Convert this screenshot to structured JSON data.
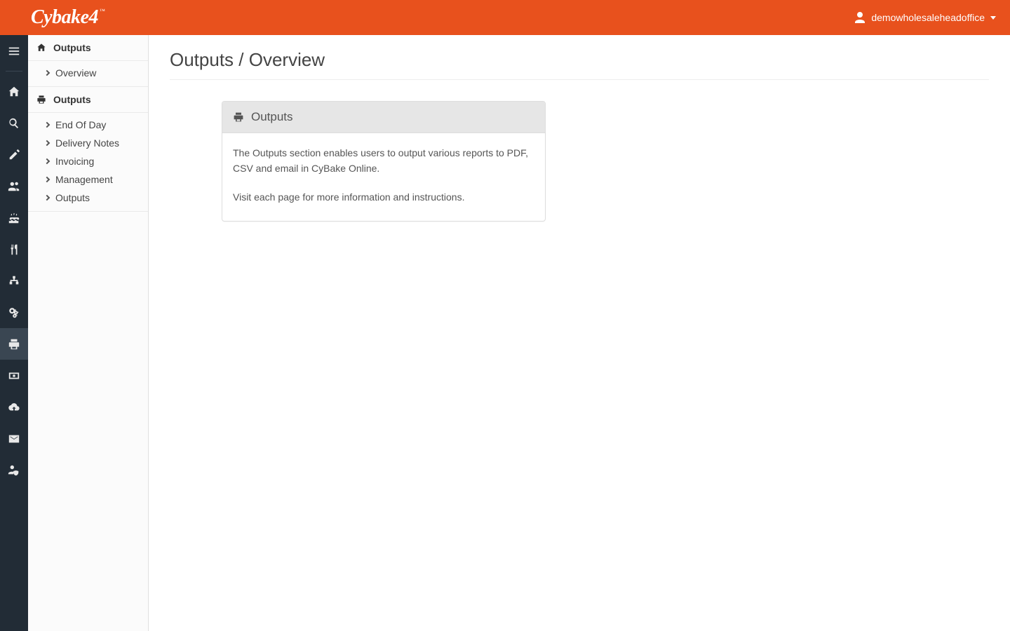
{
  "brand": "Cybake4",
  "header": {
    "username": "demowholesaleheadoffice"
  },
  "rail": [
    {
      "id": "menu",
      "icon": "bars-icon"
    },
    {
      "id": "home",
      "icon": "home-icon"
    },
    {
      "id": "search",
      "icon": "search-icon"
    },
    {
      "id": "edit",
      "icon": "edit-icon"
    },
    {
      "id": "users",
      "icon": "users-icon"
    },
    {
      "id": "cake",
      "icon": "cake-icon"
    },
    {
      "id": "food",
      "icon": "utensils-icon"
    },
    {
      "id": "org",
      "icon": "sitemap-icon"
    },
    {
      "id": "cogs",
      "icon": "cogs-icon"
    },
    {
      "id": "print",
      "icon": "print-icon",
      "active": true
    },
    {
      "id": "money",
      "icon": "money-icon"
    },
    {
      "id": "cloud",
      "icon": "cloud-download-icon"
    },
    {
      "id": "mail",
      "icon": "envelope-icon"
    },
    {
      "id": "admin",
      "icon": "user-shield-icon"
    }
  ],
  "sidebar": {
    "section1": {
      "title": "Outputs",
      "items": [
        {
          "label": "Overview"
        }
      ]
    },
    "section2": {
      "title": "Outputs",
      "items": [
        {
          "label": "End Of Day"
        },
        {
          "label": "Delivery Notes"
        },
        {
          "label": "Invoicing"
        },
        {
          "label": "Management"
        },
        {
          "label": "Outputs"
        }
      ]
    }
  },
  "main": {
    "page_title": "Outputs / Overview",
    "panel": {
      "heading": "Outputs",
      "para1": "The Outputs section enables users to output various reports to PDF, CSV and email in CyBake Online.",
      "para2": "Visit each page for more information and instructions."
    }
  }
}
